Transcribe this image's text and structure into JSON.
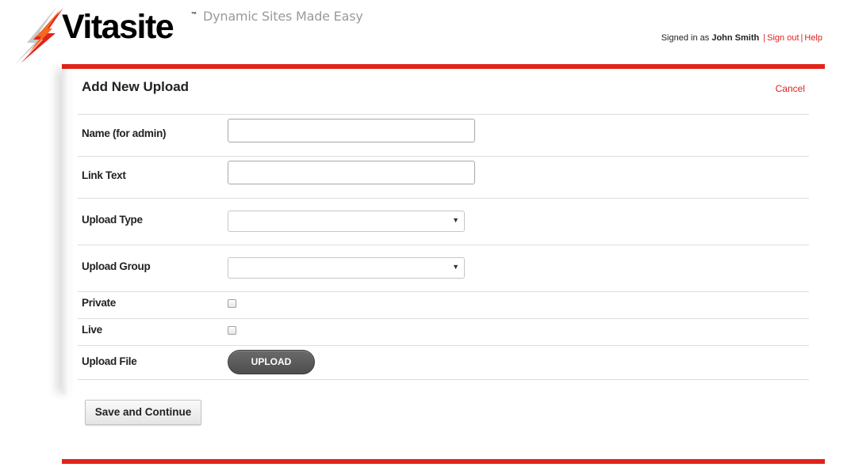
{
  "header": {
    "logo_text": "Vitasite",
    "logo_tm": "™",
    "tagline": "Dynamic Sites Made Easy",
    "signed_in_prefix": "Signed in as",
    "user_name": "John Smith",
    "sign_out_label": "Sign out",
    "separator": "|",
    "help_label": "Help"
  },
  "form": {
    "title": "Add New Upload",
    "cancel_label": "Cancel",
    "fields": {
      "name": {
        "label": "Name (for admin)",
        "value": ""
      },
      "link_text": {
        "label": "Link Text",
        "value": ""
      },
      "upload_type": {
        "label": "Upload Type",
        "selected": ""
      },
      "upload_group": {
        "label": "Upload Group",
        "selected": ""
      },
      "private": {
        "label": "Private",
        "checked": false
      },
      "live": {
        "label": "Live",
        "checked": false
      },
      "upload_file": {
        "label": "Upload File",
        "button_label": "UPLOAD"
      }
    },
    "save_label": "Save and Continue"
  },
  "colors": {
    "accent": "#e2231a",
    "link": "#e02020",
    "tagline": "#9a9a9a",
    "upload_button": "#5a5a5a"
  },
  "icons": {
    "logo": "lightning-bolt-icon",
    "select_arrow": "triangle-down-icon"
  }
}
